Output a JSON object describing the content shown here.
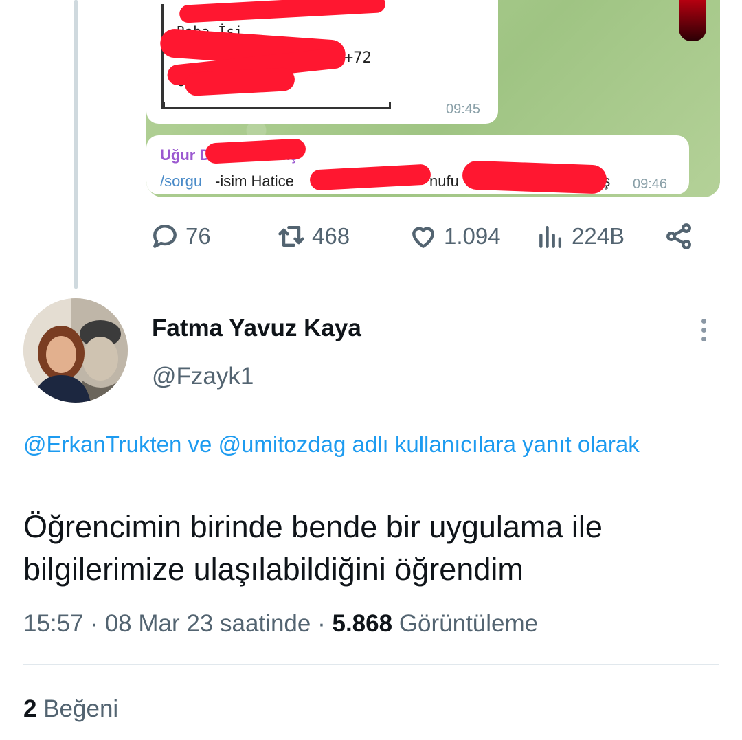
{
  "media": {
    "line_baba": "Baba İsi",
    "line_suffix": "+72",
    "line_u": "Uy",
    "time1": "09:45",
    "sender": "Uğur D",
    "sender_tail": "aş",
    "command": "/sorgu",
    "cmd_text": "-isim Hatice",
    "cmd_text2": "nufu",
    "cmd_tail": "aş",
    "time2": "09:46",
    "redaction_color": "#ff1730",
    "telegram_bg": "#a9c98d"
  },
  "actions": {
    "replies": "76",
    "retweets": "468",
    "likes": "1.094",
    "views": "224B"
  },
  "author": {
    "name": "Fatma Yavuz Kaya",
    "handle": "@Fzayk1"
  },
  "reply_context": {
    "mention1": "@ErkanTrukten",
    "joiner": "ve",
    "mention2": "@umitozdag",
    "suffix": "adlı kullanıcılara yanıt olarak"
  },
  "tweet": {
    "text": "Öğrencimin birinde bende bir uygulama ile bilgilerimize ulaşılabildiğini öğrendim",
    "time": "15:57",
    "date": "08 Mar 23 saatinde",
    "views_count": "5.868",
    "views_label": "Görüntüleme"
  },
  "footer": {
    "likes_count": "2",
    "likes_label": "Beğeni"
  },
  "colors": {
    "accent": "#1d9bf0",
    "secondary_text": "#536471",
    "primary_text": "#0f1419"
  },
  "icons": [
    "reply-icon",
    "retweet-icon",
    "like-icon",
    "views-icon",
    "share-icon",
    "more-icon"
  ]
}
